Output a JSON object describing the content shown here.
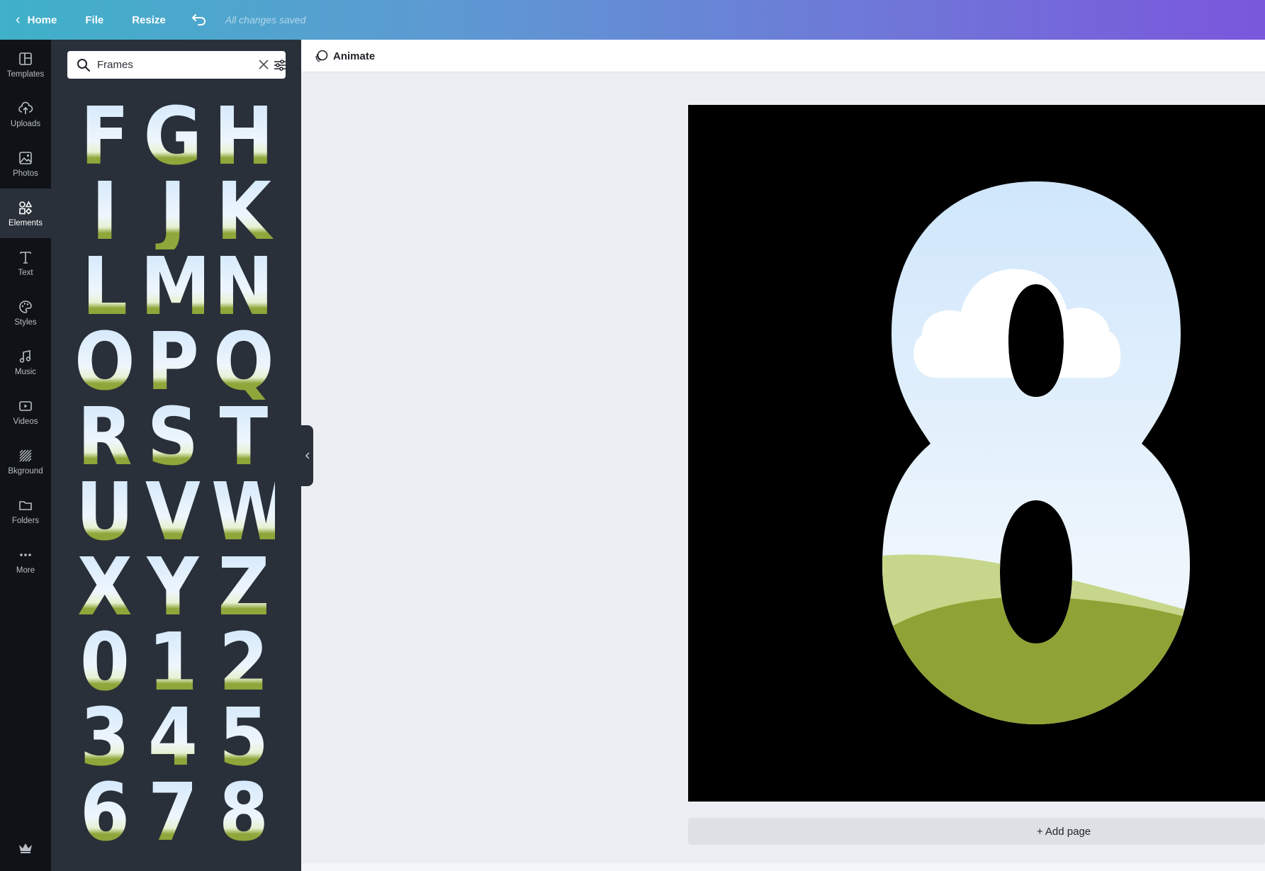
{
  "topbar": {
    "home_label": "Home",
    "file_label": "File",
    "resize_label": "Resize",
    "status_text": "All changes saved"
  },
  "rail": {
    "items": [
      {
        "label": "Templates",
        "icon": "templates-icon"
      },
      {
        "label": "Uploads",
        "icon": "upload-cloud-icon"
      },
      {
        "label": "Photos",
        "icon": "photo-icon"
      },
      {
        "label": "Elements",
        "icon": "shapes-icon",
        "active": true
      },
      {
        "label": "Text",
        "icon": "text-icon"
      },
      {
        "label": "Styles",
        "icon": "palette-icon"
      },
      {
        "label": "Music",
        "icon": "music-note-icon"
      },
      {
        "label": "Videos",
        "icon": "video-play-icon"
      },
      {
        "label": "Bkground",
        "icon": "background-hatch-icon"
      },
      {
        "label": "Folders",
        "icon": "folder-icon"
      },
      {
        "label": "More",
        "icon": "more-dots-icon"
      }
    ]
  },
  "search": {
    "value": "Frames"
  },
  "frames": {
    "glyphs": [
      [
        "F",
        "G",
        "H"
      ],
      [
        "I",
        "J",
        "K"
      ],
      [
        "L",
        "M",
        "N"
      ],
      [
        "O",
        "P",
        "Q"
      ],
      [
        "R",
        "S",
        "T"
      ],
      [
        "U",
        "V",
        "W"
      ],
      [
        "X",
        "Y",
        "Z"
      ],
      [
        "0",
        "1",
        "2"
      ],
      [
        "3",
        "4",
        "5"
      ],
      [
        "6",
        "7",
        "8"
      ]
    ]
  },
  "editor": {
    "animate_label": "Animate",
    "add_page_label": "+ Add page",
    "canvas_frame_glyph": "8"
  },
  "colors": {
    "topbar_start": "#3fb1c8",
    "topbar_end": "#7a57dc",
    "rail_bg": "#0f1217",
    "panel_bg": "#293039",
    "canvas_bg": "#000000",
    "sky": "#d3e8fb",
    "grass": "#8fa63a"
  }
}
